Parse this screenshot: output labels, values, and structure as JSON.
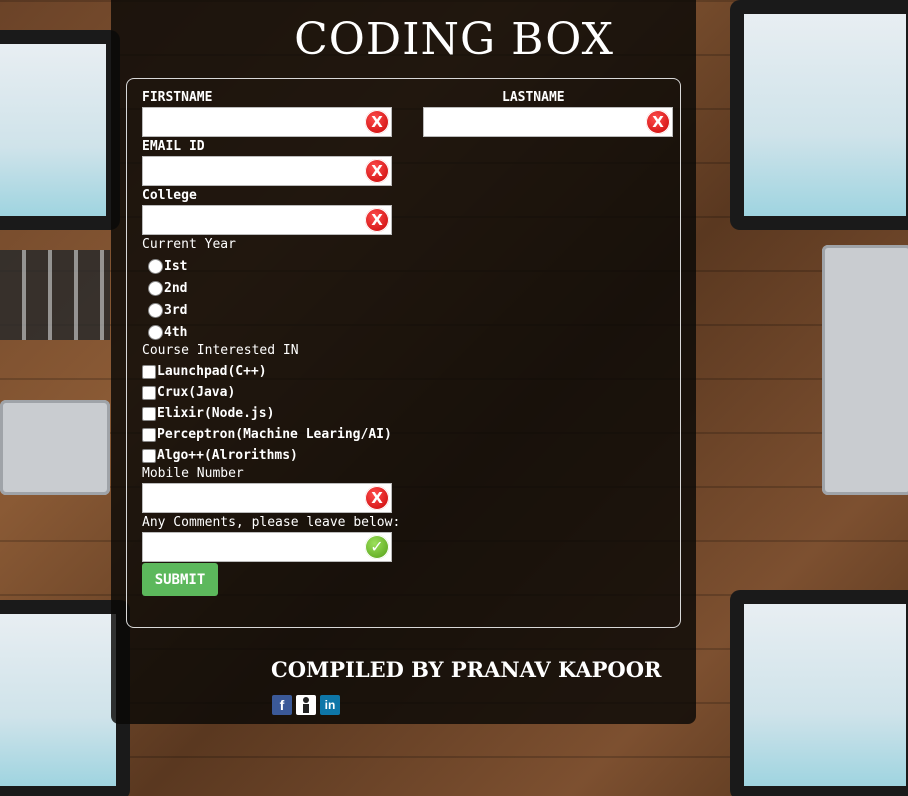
{
  "header": {
    "title": "CODING BOX"
  },
  "form": {
    "firstname_label": "FIRSTNAME",
    "lastname_label": "LASTNAME",
    "email_label": "EMAIL ID",
    "college_label": "College",
    "current_year_label": "Current Year",
    "year_options": [
      "Ist",
      "2nd",
      "3rd",
      "4th"
    ],
    "course_label": "Course Interested IN",
    "course_options": [
      "Launchpad(C++)",
      "Crux(Java)",
      "Elixir(Node.js)",
      "Perceptron(Machine Learing/AI)",
      "Algo++(Alrorithms)"
    ],
    "mobile_label": "Mobile Number",
    "comments_label": "Any Comments, please leave below:",
    "submit_label": "SUBMIT",
    "invalid_glyph": "X",
    "valid_glyph": "✓"
  },
  "footer": {
    "compiled_by": "COMPILED BY PRANAV KAPOOR",
    "social": [
      {
        "icon": "facebook-icon",
        "glyph": "f",
        "color": "#3b5998"
      },
      {
        "icon": "profile-icon",
        "glyph": "",
        "color": "#ffffff"
      },
      {
        "icon": "linkedin-icon",
        "glyph": "in",
        "color": "#0e76a8"
      }
    ]
  }
}
